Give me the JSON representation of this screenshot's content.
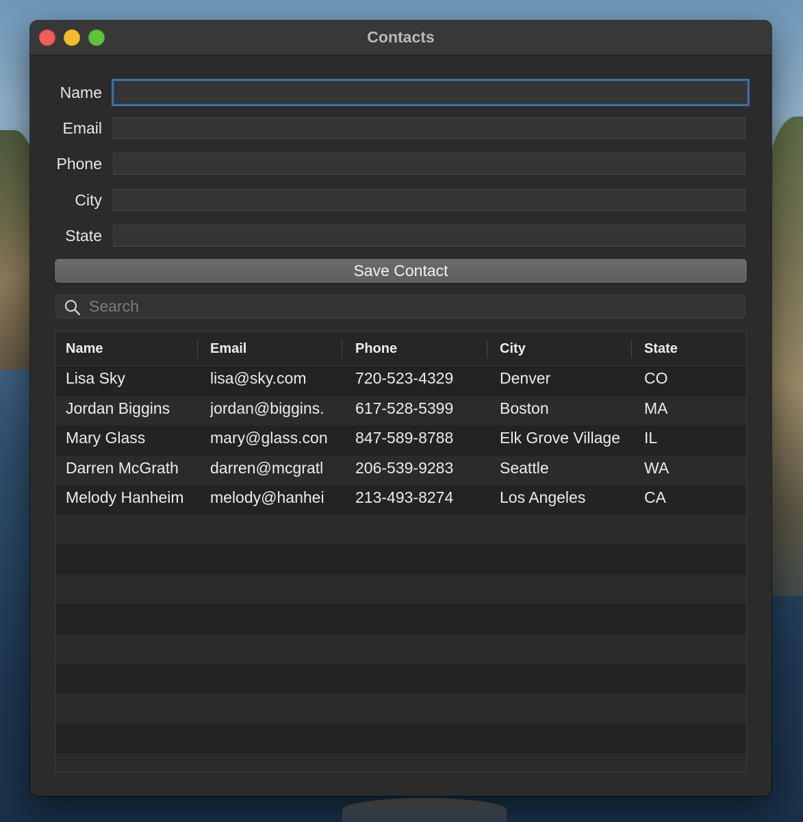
{
  "window": {
    "title": "Contacts"
  },
  "form": {
    "fields": [
      {
        "label": "Name",
        "value": "",
        "placeholder": ""
      },
      {
        "label": "Email",
        "value": "",
        "placeholder": ""
      },
      {
        "label": "Phone",
        "value": "",
        "placeholder": ""
      },
      {
        "label": "City",
        "value": "",
        "placeholder": ""
      },
      {
        "label": "State",
        "value": "",
        "placeholder": ""
      }
    ],
    "save_label": "Save Contact"
  },
  "search": {
    "placeholder": "Search",
    "value": ""
  },
  "table": {
    "columns": [
      "Name",
      "Email",
      "Phone",
      "City",
      "State"
    ],
    "rows": [
      [
        "Lisa Sky",
        "lisa@sky.com",
        "720-523-4329",
        "Denver",
        "CO"
      ],
      [
        "Jordan Biggins",
        "jordan@biggins.",
        "617-528-5399",
        "Boston",
        "MA"
      ],
      [
        "Mary Glass",
        "mary@glass.con",
        "847-589-8788",
        "Elk Grove Village",
        "IL"
      ],
      [
        "Darren McGrath",
        "darren@mcgratl",
        "206-539-9283",
        "Seattle",
        "WA"
      ],
      [
        "Melody Hanheim",
        "melody@hanhei",
        "213-493-8274",
        "Los Angeles",
        "CA"
      ]
    ]
  },
  "colors": {
    "accent_focus": "#3d6f9f",
    "window_bg": "#2b2b2b",
    "close": "#ee5e57",
    "minimize": "#f4bc2f",
    "maximize": "#5ec23f"
  },
  "icons": {
    "search": "search-icon",
    "close": "close-icon",
    "minimize": "minimize-icon",
    "maximize": "maximize-icon"
  }
}
